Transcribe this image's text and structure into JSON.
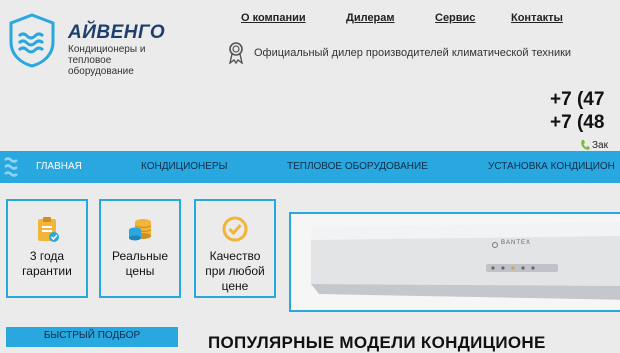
{
  "brand": {
    "name": "АЙВЕНГО",
    "tagline": "Кондиционеры и тепловое оборудование",
    "accent": "#29a8e0",
    "dark": "#1d3f6e"
  },
  "top_nav": [
    "О компании",
    "Дилерам",
    "Сервис",
    "Контакты"
  ],
  "dealer_text": "Официальный дилер производителей климатической техники",
  "phones": [
    "+7 (47",
    "+7 (48"
  ],
  "callback": "Зак",
  "main_nav": [
    "ГЛАВНАЯ",
    "КОНДИЦИОНЕРЫ",
    "ТЕПЛОВОЕ ОБОРУДОВАНИЕ",
    "УСТАНОВКА КОНДИЦИОН"
  ],
  "features": [
    {
      "label": "3 года гарантии",
      "icon": "clipboard-check-icon"
    },
    {
      "label": "Реальные цены",
      "icon": "coins-icon"
    },
    {
      "label": "Качество при любой цене",
      "icon": "check-circle-icon"
    }
  ],
  "banner": {
    "product_brand": "BANTEX"
  },
  "quick_select": "БЫСТРЫЙ ПОДБОР",
  "popular_heading": "ПОПУЛЯРНЫЕ МОДЕЛИ КОНДИЦИОНЕ"
}
